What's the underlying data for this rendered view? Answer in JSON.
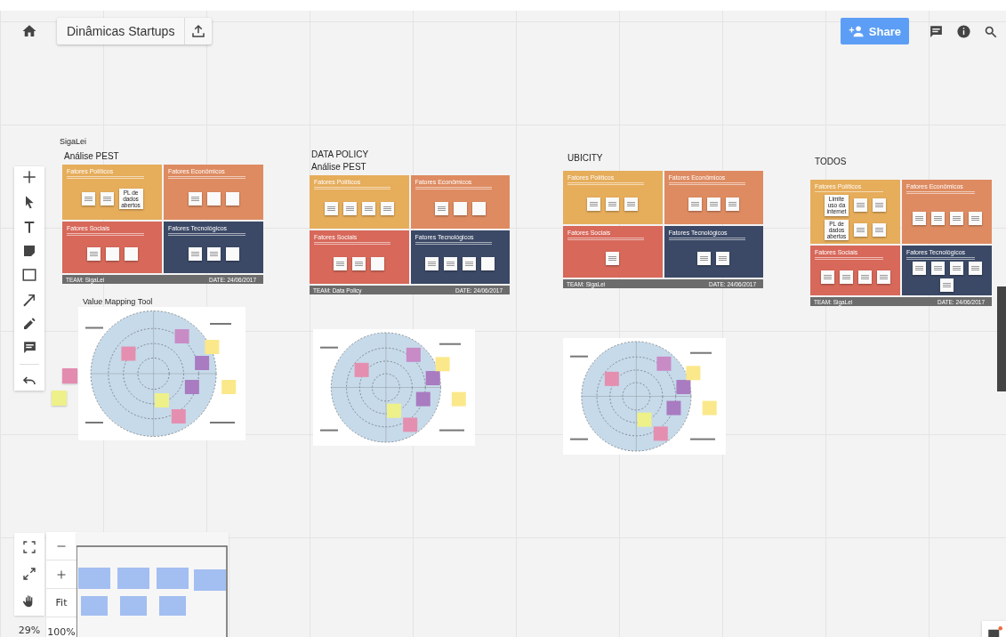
{
  "document": {
    "title": "Dinâmicas Startups"
  },
  "share_button": {
    "label": "Share"
  },
  "boards": [
    {
      "heading": "SigaLei",
      "subheading": "Análise PEST",
      "quadrants": [
        {
          "label": "Fatores Políticos",
          "color": "#e6ad5b",
          "notes": [
            {
              "kind": "scribble"
            },
            {
              "kind": "scribble"
            },
            {
              "kind": "text",
              "text": "PL de dados abertos"
            }
          ]
        },
        {
          "label": "Fatores Econômicos",
          "color": "#de8b61",
          "notes": [
            {
              "kind": "scribble"
            },
            {
              "kind": "blank"
            },
            {
              "kind": "blank"
            }
          ]
        },
        {
          "label": "Fatores Sociais",
          "color": "#d7685a",
          "notes": [
            {
              "kind": "scribble"
            },
            {
              "kind": "blank"
            },
            {
              "kind": "blank"
            }
          ]
        },
        {
          "label": "Fatores Tecnológicos",
          "color": "#3b4966",
          "notes": [
            {
              "kind": "scribble"
            },
            {
              "kind": "scribble"
            },
            {
              "kind": "blank"
            }
          ]
        }
      ],
      "team": "TEAM: SigaLei",
      "date": "DATE: 24/06/2017"
    },
    {
      "heading": "DATA POLICY",
      "subheading": "Análise PEST",
      "quadrants": [
        {
          "label": "Fatores Políticos",
          "color": "#e6ad5b",
          "notes": [
            {
              "kind": "scribble"
            },
            {
              "kind": "scribble"
            },
            {
              "kind": "scribble"
            },
            {
              "kind": "scribble"
            }
          ]
        },
        {
          "label": "Fatores Econômicos",
          "color": "#de8b61",
          "notes": [
            {
              "kind": "scribble"
            },
            {
              "kind": "blank"
            },
            {
              "kind": "blank"
            }
          ]
        },
        {
          "label": "Fatores Sociais",
          "color": "#d7685a",
          "notes": [
            {
              "kind": "scribble"
            },
            {
              "kind": "scribble"
            },
            {
              "kind": "blank"
            }
          ]
        },
        {
          "label": "Fatores Tecnológicos",
          "color": "#3b4966",
          "notes": [
            {
              "kind": "scribble"
            },
            {
              "kind": "scribble"
            },
            {
              "kind": "scribble"
            },
            {
              "kind": "blank"
            }
          ]
        }
      ],
      "team": "TEAM: Data Policy",
      "date": "DATE: 24/06/2017"
    },
    {
      "heading": "UBICITY",
      "quadrants": [
        {
          "label": "Fatores Políticos",
          "color": "#e6ad5b",
          "notes": [
            {
              "kind": "scribble"
            },
            {
              "kind": "scribble"
            },
            {
              "kind": "scribble"
            }
          ]
        },
        {
          "label": "Fatores Econômicos",
          "color": "#de8b61",
          "notes": [
            {
              "kind": "scribble"
            },
            {
              "kind": "scribble"
            },
            {
              "kind": "scribble"
            }
          ]
        },
        {
          "label": "Fatores Sociais",
          "color": "#d7685a",
          "notes": [
            {
              "kind": "scribble"
            }
          ]
        },
        {
          "label": "Fatores Tecnológicos",
          "color": "#3b4966",
          "notes": [
            {
              "kind": "scribble"
            },
            {
              "kind": "scribble"
            }
          ]
        }
      ],
      "team": "TEAM: SigaLei",
      "date": "DATE: 24/06/2017"
    },
    {
      "heading": "TODOS",
      "quadrants": [
        {
          "label": "Fatores Políticos",
          "color": "#e6ad5b",
          "notes": [
            {
              "kind": "text",
              "text": "Limite uso da internet"
            },
            {
              "kind": "scribble"
            },
            {
              "kind": "scribble"
            },
            {
              "kind": "text",
              "text": "PL de dados abertos"
            },
            {
              "kind": "scribble"
            },
            {
              "kind": "scribble"
            }
          ]
        },
        {
          "label": "Fatores Econômicos",
          "color": "#de8b61",
          "notes": [
            {
              "kind": "scribble"
            },
            {
              "kind": "scribble"
            },
            {
              "kind": "scribble"
            },
            {
              "kind": "scribble"
            }
          ]
        },
        {
          "label": "Fatores Sociais",
          "color": "#d7685a",
          "notes": [
            {
              "kind": "scribble"
            },
            {
              "kind": "scribble"
            },
            {
              "kind": "scribble"
            },
            {
              "kind": "scribble"
            }
          ]
        },
        {
          "label": "Fatores Tecnológicos",
          "color": "#3b4966",
          "notes": [
            {
              "kind": "scribble"
            },
            {
              "kind": "scribble"
            },
            {
              "kind": "scribble"
            },
            {
              "kind": "scribble"
            },
            {
              "kind": "scribble"
            }
          ]
        }
      ],
      "team": "TEAM: SigaLei",
      "date": "DATE: 24/06/2017"
    }
  ],
  "value_maps": [
    {
      "kind": "diagram",
      "title": "Value Mapping Tool"
    },
    {
      "kind": "diagram"
    },
    {
      "kind": "diagram"
    }
  ],
  "zoom_controls": {
    "level": "29%",
    "fit": "Fit",
    "actual": "100%"
  }
}
